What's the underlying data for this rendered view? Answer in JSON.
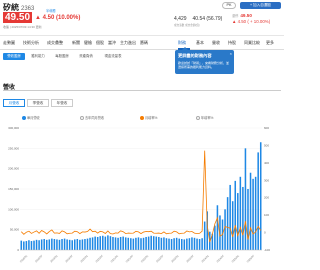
{
  "stock": {
    "name": "矽統",
    "code": "2363",
    "tag": "半導體",
    "price": "49.50",
    "change": "▲ 4.50 (10.00%)",
    "datetime": "收盤 | 2025/07/09 14:30 更新",
    "volume": "4,429",
    "amount": "40.54 (56.79)",
    "stats_labels": "成交張數   成交金額(億)",
    "pk_label": "PK",
    "favorite_label": "+ 加入自選股",
    "limit_label": "漲停",
    "limit_value": "49.50",
    "limit_pct": "▲ 4.50 ( + 10.00%)"
  },
  "nav": {
    "items": [
      "走勢圖",
      "技術分析",
      "成交彙整",
      "新聞",
      "健檢",
      "個股",
      "當沖",
      "主力進出",
      "籌碼",
      "財務",
      "基本",
      "營收",
      "持股",
      "同業比較",
      "更多"
    ],
    "active": "財務"
  },
  "subnav": {
    "items": [
      "營收盈餘",
      "獲利能力",
      "每股盈餘",
      "資產負債",
      "現金流量表"
    ],
    "active": "營收盈餘"
  },
  "tooltip": {
    "title": "更詳盡的財務內容",
    "body": "歡迎試試『財報』，來看財務分析，並選擇所需的獲利能力資料。",
    "close": "×"
  },
  "section": {
    "title": "營收"
  },
  "period_tabs": {
    "items": [
      "月營收",
      "季營收",
      "年營收"
    ],
    "active": "月營收"
  },
  "legend": {
    "items": [
      {
        "label": "單月營收",
        "state": "on-blue"
      },
      {
        "label": "去年同月營收",
        "state": "off"
      },
      {
        "label": "月增率%",
        "state": "on-org"
      },
      {
        "label": "年增率%",
        "state": "off"
      }
    ]
  },
  "colors": {
    "bar": "#1e88e5",
    "line": "#f57c00",
    "brand": "#2b6ec3",
    "up": "#e53935"
  },
  "chart_data": {
    "type": "bar",
    "title": "營收",
    "left_axis_ticks": [
      "300,000",
      "250,000",
      "200,000",
      "150,000",
      "100,000",
      "50,000",
      "0"
    ],
    "right_axis_ticks": [
      "600",
      "500",
      "400",
      "300",
      "200",
      "100",
      "0",
      "-100"
    ],
    "ylim_left": [
      0,
      300000
    ],
    "ylim_right": [
      -100,
      600
    ],
    "x_ticks": [
      "2018/01",
      "2018/07",
      "2019/01",
      "2019/07",
      "2020/01",
      "2020/07",
      "2021/01",
      "2021/07",
      "2022/01",
      "2022/07",
      "2023/01",
      "2023/07",
      "2024/01",
      "2024/07",
      "2025/01",
      "2025/07"
    ],
    "series": [
      {
        "name": "單月營收",
        "axis": "left",
        "values": [
          23000,
          21000,
          22000,
          24000,
          22000,
          23000,
          25000,
          24000,
          26000,
          27000,
          25000,
          26000,
          28000,
          27000,
          26000,
          25000,
          27000,
          28000,
          26000,
          25000,
          24000,
          26000,
          27000,
          25000,
          26000,
          27000,
          28000,
          30000,
          31000,
          33000,
          32000,
          34000,
          35000,
          33000,
          36000,
          34000,
          32000,
          31000,
          30000,
          32000,
          33000,
          31000,
          30000,
          29000,
          28000,
          30000,
          31000,
          29000,
          30000,
          32000,
          33000,
          35000,
          34000,
          33000,
          32000,
          30000,
          31000,
          29000,
          28000,
          27000,
          29000,
          30000,
          28000,
          27000,
          26000,
          28000,
          29000,
          31000,
          30000,
          28000,
          27000,
          29000,
          70000,
          95000,
          45000,
          40000,
          60000,
          110000,
          85000,
          75000,
          100000,
          130000,
          160000,
          120000,
          170000,
          140000,
          180000,
          155000,
          250000,
          150000,
          190000,
          175000,
          180000,
          240000,
          265000
        ]
      },
      {
        "name": "月增率%",
        "axis": "right",
        "values": [
          5,
          -10,
          2,
          8,
          -5,
          3,
          10,
          -4,
          12,
          4,
          -8,
          6,
          15,
          -3,
          -2,
          -5,
          10,
          4,
          -7,
          -4,
          -3,
          8,
          5,
          -6,
          4,
          3,
          6,
          20,
          5,
          8,
          -3,
          7,
          4,
          -5,
          9,
          -6,
          -8,
          -2,
          -3,
          10,
          5,
          -6,
          -3,
          -4,
          -3,
          7,
          4,
          -6,
          3,
          6,
          5,
          8,
          -3,
          -4,
          -3,
          -6,
          4,
          -7,
          -4,
          -3,
          8,
          4,
          -7,
          -4,
          -3,
          9,
          4,
          6,
          -3,
          -6,
          -4,
          8,
          470,
          40,
          -55,
          -10,
          50,
          85,
          -20,
          -12,
          35,
          30,
          25,
          -25,
          42,
          -18,
          30,
          -15,
          65,
          -40,
          28,
          -8,
          3,
          35,
          12
        ]
      }
    ]
  }
}
